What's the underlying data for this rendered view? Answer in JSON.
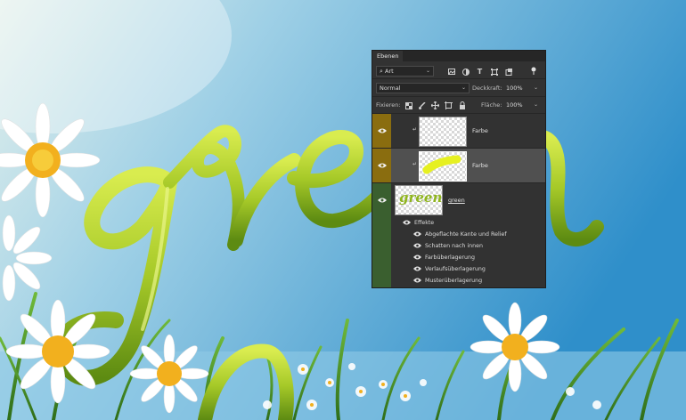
{
  "canvas": {
    "word": "green",
    "sky_top": "#cfe6ea",
    "sky_bottom": "#3e9fd0",
    "letter_color": "#a6c928"
  },
  "panel": {
    "tab_label": "Ebenen",
    "filter": {
      "label": "Art",
      "icon": "search-icon"
    },
    "filter_icons": [
      "image-filter-icon",
      "adjustment-filter-icon",
      "type-filter-icon",
      "shape-filter-icon",
      "smartobject-filter-icon",
      "filter-toggle-icon"
    ],
    "blend_mode": "Normal",
    "opacity_label": "Deckkraft:",
    "opacity_value": "100%",
    "lock_label": "Fixieren:",
    "lock_icons": [
      "lock-transparent-icon",
      "lock-paint-icon",
      "lock-position-icon",
      "lock-artboard-icon",
      "lock-all-icon"
    ],
    "fill_label": "Fläche:",
    "fill_value": "100%",
    "layers": [
      {
        "name": "Farbe",
        "color_tag": "#8a6d0f",
        "selected": false,
        "clipped": true
      },
      {
        "name": "Farbe",
        "color_tag": "#8a6d0f",
        "selected": true,
        "clipped": true
      },
      {
        "name": "green",
        "color_tag": "#3a5f2f",
        "selected": false,
        "clipped": false,
        "thumb_text": "green"
      }
    ],
    "effects_label": "Effekte",
    "effects": [
      "Abgeflachte Kante und Relief",
      "Schatten nach innen",
      "Farbüberlagerung",
      "Verlaufsüberlagerung",
      "Musterüberlagerung"
    ]
  }
}
